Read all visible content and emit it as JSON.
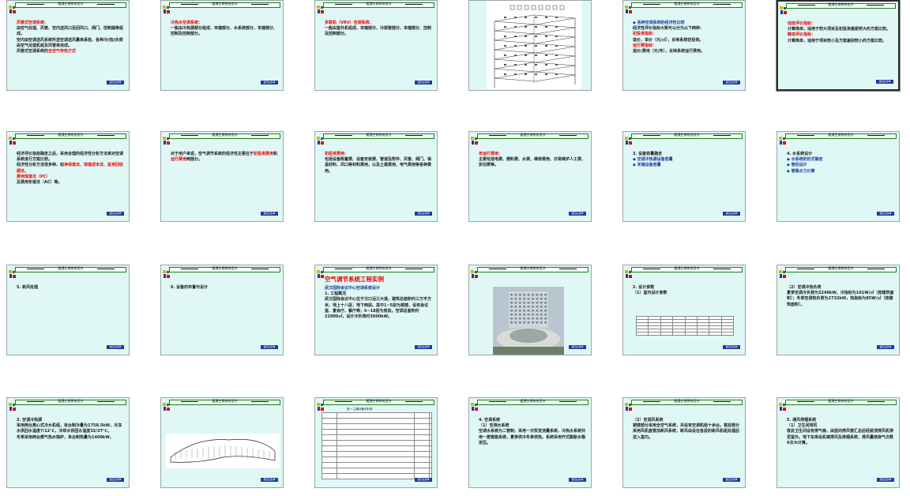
{
  "header_text": "暖通空调系统设计",
  "button_label": "返回主菜单",
  "slides": [
    {
      "id": 1,
      "lines": [
        {
          "c": "r",
          "t": "风管式空调系统："
        },
        {
          "c": "k",
          "t": "由空气处理、风管、空内送风口及回风口、阀门、控制器等组成。"
        },
        {
          "c": "k",
          "t": "空内由空调送风系统所送空调送风量来承担，各种冷(热)负荷由空气处理机组及风管来完成。"
        },
        {
          "c": "k",
          "t": "风管式空调系统的"
        },
        {
          "c": "r",
          "t": "全空气传热方式"
        }
      ]
    },
    {
      "id": 2,
      "lines": [
        {
          "c": "r",
          "t": "冷热水空调系统："
        },
        {
          "c": "k",
          "t": "一般由冷热源部分组成、末端部分、水系统部分、末端部分、控制及控制部分。"
        }
      ]
    },
    {
      "id": 3,
      "lines": [
        {
          "c": "r",
          "t": "多联机（VRV）空调系统："
        },
        {
          "c": "k",
          "t": "一般由室外机组成、末端部分、冷媒管部分、末端部分、控制及控制部分。"
        }
      ]
    },
    {
      "id": 4,
      "lines": []
    },
    {
      "id": 5,
      "lines": [
        {
          "c": "b",
          "t": "◆ 各种空调系统的经济性比较"
        },
        {
          "c": "k",
          "t": "经济性评价指标大致可以分为以下两种："
        },
        {
          "c": "r",
          "t": "初投资指标："
        },
        {
          "c": "k",
          "t": "造价、单价（元/㎡），反映系统初投资。"
        },
        {
          "c": "r",
          "t": "运行费指标："
        },
        {
          "c": "k",
          "t": "造价/费用（元/年），反映系统运行费用。"
        }
      ]
    },
    {
      "id": 6,
      "lines": [
        {
          "c": "r",
          "t": "动态评价指标："
        },
        {
          "c": "k",
          "t": "计算简单，适用于较大项目及初投资差距较大的方案比较。"
        },
        {
          "c": "r",
          "t": "静态评价指标："
        },
        {
          "c": "k",
          "t": "计算简单，适用于项目较小及方案差别较小的方案比较。"
        }
      ]
    },
    {
      "id": 7,
      "lines": [
        {
          "c": "k",
          "t": "经济评价指标确定之后，采用合理的经济性分析方法来对空调系统进行方案比较。"
        },
        {
          "c": "k",
          "t": "经济性分析方法很多种，如"
        },
        {
          "c": "r",
          "t": "净现值法、现值成本法、投资回收期法"
        },
        {
          "c": "k",
          "t": "、"
        },
        {
          "c": "r",
          "t": "费用现值法（PC）"
        },
        {
          "c": "k",
          "t": "及费用年值法（AC）等。"
        }
      ]
    },
    {
      "id": 8,
      "lines": [
        {
          "c": "k",
          "t": "对于用户来说，空气调节系统的经济性主要在于"
        },
        {
          "c": "r",
          "t": "初投资费用"
        },
        {
          "c": "k",
          "t": "和"
        },
        {
          "c": "r",
          "t": "运行费用"
        },
        {
          "c": "k",
          "t": "两部分。"
        }
      ]
    },
    {
      "id": 9,
      "lines": [
        {
          "c": "r",
          "t": "初投资费用："
        },
        {
          "c": "k",
          "t": "包括设备购置费、设备安装费、管道及附件、风管、阀门、保温材料、风口等材料费用，以及土建费用、电气费用等各种费用。"
        }
      ]
    },
    {
      "id": 10,
      "lines": [
        {
          "c": "r",
          "t": "年运行费用："
        },
        {
          "c": "k",
          "t": "主要包括电费、燃料费、水费、维修费用、日常维护人工费、折旧费等。"
        }
      ]
    },
    {
      "id": 11,
      "lines": [
        {
          "c": "k",
          "t": "3. 设备容量确定"
        },
        {
          "c": "b",
          "t": "◆ 空调冷热源设备容量"
        },
        {
          "c": "b",
          "t": "◆ 末端设备容量"
        }
      ]
    },
    {
      "id": 12,
      "lines": [
        {
          "c": "k",
          "t": "4. 水系统设计"
        },
        {
          "c": "b",
          "t": "◆ 水系统的形式确定"
        },
        {
          "c": "b",
          "t": "◆ 管径设计"
        },
        {
          "c": "b",
          "t": "◆ 管路水力计算"
        }
      ]
    },
    {
      "id": 13,
      "lines": [
        {
          "c": "k",
          "t": "5. 新风处理"
        }
      ]
    },
    {
      "id": 14,
      "lines": [
        {
          "c": "k",
          "t": "6. 设备的布置与设计"
        }
      ]
    },
    {
      "id": 15,
      "title": "空气调节系统工程实例",
      "lines": [
        {
          "c": "b",
          "t": "武汉国际会议中心空调系统设计"
        },
        {
          "c": "k",
          "t": "1. 工程概况"
        },
        {
          "c": "k",
          "t": "武汉国际会议中心位于汉口沿江大道，建筑总面积约三万平方米，地上十八层，地下两层。其中1~5层为裙楼，设有会议室、宴会厅、餐厅等；6~18层为客房。空调总面积约22000㎡，设计冷负荷约3000kW。"
        }
      ]
    },
    {
      "id": 16,
      "lines": []
    },
    {
      "id": 17,
      "lines": [
        {
          "c": "k",
          "t": "2. 设计参数"
        },
        {
          "c": "k",
          "t": "（1）室内设计参数"
        }
      ]
    },
    {
      "id": 18,
      "lines": [
        {
          "c": "k",
          "t": "（2）空调冷热负荷"
        },
        {
          "c": "k",
          "t": "夏季空调冷负荷为3240kW，冷指标为101W/㎡（按建筑面积）；冬季空调热负荷为2732kW，热指标为85W/㎡（按建筑面积）。"
        }
      ]
    },
    {
      "id": 19,
      "lines": [
        {
          "c": "k",
          "t": "3. 空调冷热源"
        },
        {
          "c": "k",
          "t": "采用两台离心式冷水机组，单台制冷量为1758.5kW，冷冻水供回水温度7/12℃，冷却水供回水温度32/37℃。"
        },
        {
          "c": "k",
          "t": "冬季采用两台燃气热水锅炉，单台制热量为1400kW。"
        }
      ]
    },
    {
      "id": 20,
      "lines": []
    },
    {
      "id": 21,
      "title_small": "表一  主要设备材料表",
      "lines": []
    },
    {
      "id": 22,
      "lines": [
        {
          "c": "k",
          "t": "4. 空调系统"
        },
        {
          "c": "k",
          "t": "（1）空调水系统"
        },
        {
          "c": "k",
          "t": "空调水系统为二管制，采用一次泵变流量系统，冷热水系统共用一套管路系统，夏季供冷冬季供热，系统采用开式膨胀水箱定压。"
        }
      ]
    },
    {
      "id": 23,
      "lines": [
        {
          "c": "k",
          "t": "（2）空调风系统"
        },
        {
          "c": "k",
          "t": "裙楼部分采用全空气系统，共设有空调机组十余台。客房部分采用风机盘管加新风系统，新风由设在各层的新风机组处理后送入室内。"
        }
      ]
    },
    {
      "id": 24,
      "lines": [
        {
          "c": "k",
          "t": "5. 通风排烟系统"
        },
        {
          "c": "k",
          "t": "（1）卫生间排风"
        },
        {
          "c": "k",
          "t": "客房卫生间设有排气扇，由竖向排风管汇总后经屋顶排风机排至室外。地下车库设机械排风及排烟系统，排风量按换气次数6次/h计算。"
        }
      ]
    }
  ]
}
